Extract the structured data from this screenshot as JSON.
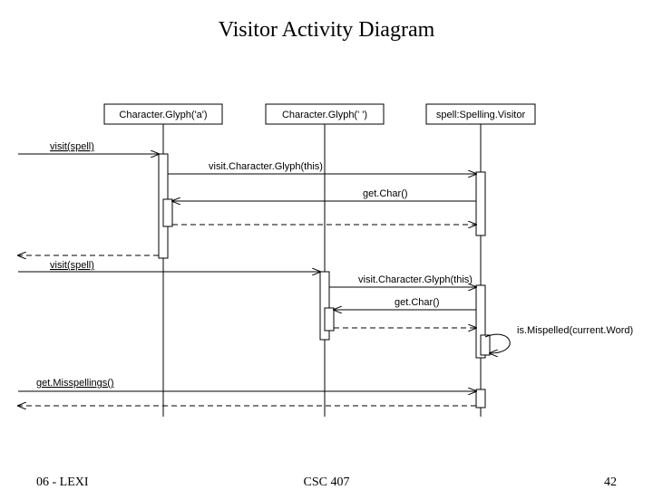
{
  "title": "Visitor Activity Diagram",
  "participants": {
    "p1": "Character.Glyph('a')",
    "p2": "Character.Glyph('  ')",
    "p3": "spell:Spelling.Visitor"
  },
  "messages": {
    "m1": "visit(spell)",
    "m2": "visit.Character.Glyph(this)",
    "m3": "get.Char()",
    "m4": "visit(spell)",
    "m5": "visit.Character.Glyph(this)",
    "m6": "get.Char()",
    "m7": "is.Mispelled(current.Word)",
    "m8": "get.Misspellings()"
  },
  "footer": {
    "left": "06 - LEXI",
    "center": "CSC 407",
    "right": "42"
  }
}
